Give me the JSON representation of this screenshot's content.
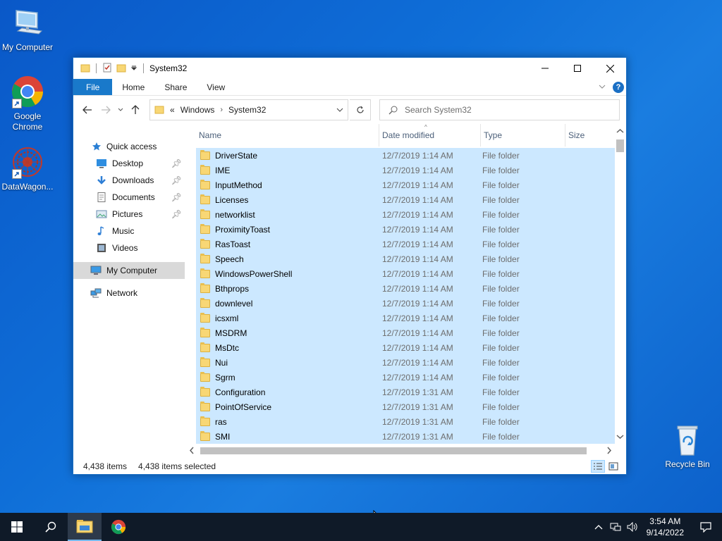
{
  "desktop": {
    "icons": [
      {
        "label": "My Computer"
      },
      {
        "label": "Google Chrome"
      },
      {
        "label": "DataWagon..."
      },
      {
        "label": "Recycle Bin"
      }
    ]
  },
  "window": {
    "title": "System32",
    "ribbon_tabs": [
      "File",
      "Home",
      "Share",
      "View"
    ],
    "help": "?",
    "breadcrumb": [
      "«",
      "Windows",
      "System32"
    ],
    "search_placeholder": "Search System32",
    "nav": {
      "quick_access": "Quick access",
      "items": [
        "Desktop",
        "Downloads",
        "Documents",
        "Pictures",
        "Music",
        "Videos"
      ],
      "my_computer": "My Computer",
      "network": "Network"
    },
    "columns": [
      "Name",
      "Date modified",
      "Type",
      "Size"
    ],
    "rows": [
      {
        "name": "DriverState",
        "date": "12/7/2019 1:14 AM",
        "type": "File folder"
      },
      {
        "name": "IME",
        "date": "12/7/2019 1:14 AM",
        "type": "File folder"
      },
      {
        "name": "InputMethod",
        "date": "12/7/2019 1:14 AM",
        "type": "File folder"
      },
      {
        "name": "Licenses",
        "date": "12/7/2019 1:14 AM",
        "type": "File folder"
      },
      {
        "name": "networklist",
        "date": "12/7/2019 1:14 AM",
        "type": "File folder"
      },
      {
        "name": "ProximityToast",
        "date": "12/7/2019 1:14 AM",
        "type": "File folder"
      },
      {
        "name": "RasToast",
        "date": "12/7/2019 1:14 AM",
        "type": "File folder"
      },
      {
        "name": "Speech",
        "date": "12/7/2019 1:14 AM",
        "type": "File folder"
      },
      {
        "name": "WindowsPowerShell",
        "date": "12/7/2019 1:14 AM",
        "type": "File folder"
      },
      {
        "name": "Bthprops",
        "date": "12/7/2019 1:14 AM",
        "type": "File folder"
      },
      {
        "name": "downlevel",
        "date": "12/7/2019 1:14 AM",
        "type": "File folder"
      },
      {
        "name": "icsxml",
        "date": "12/7/2019 1:14 AM",
        "type": "File folder"
      },
      {
        "name": "MSDRM",
        "date": "12/7/2019 1:14 AM",
        "type": "File folder"
      },
      {
        "name": "MsDtc",
        "date": "12/7/2019 1:14 AM",
        "type": "File folder"
      },
      {
        "name": "Nui",
        "date": "12/7/2019 1:14 AM",
        "type": "File folder"
      },
      {
        "name": "Sgrm",
        "date": "12/7/2019 1:14 AM",
        "type": "File folder"
      },
      {
        "name": "Configuration",
        "date": "12/7/2019 1:31 AM",
        "type": "File folder"
      },
      {
        "name": "PointOfService",
        "date": "12/7/2019 1:31 AM",
        "type": "File folder"
      },
      {
        "name": "ras",
        "date": "12/7/2019 1:31 AM",
        "type": "File folder"
      },
      {
        "name": "SMI",
        "date": "12/7/2019 1:31 AM",
        "type": "File folder"
      }
    ],
    "status": {
      "items": "4,438 items",
      "selected": "4,438 items selected"
    }
  },
  "taskbar": {
    "time": "3:54 AM",
    "date": "9/14/2022"
  },
  "colors": {
    "accent": "#1979ca",
    "selection": "#cce8ff",
    "taskbar": "#0f1a28"
  }
}
